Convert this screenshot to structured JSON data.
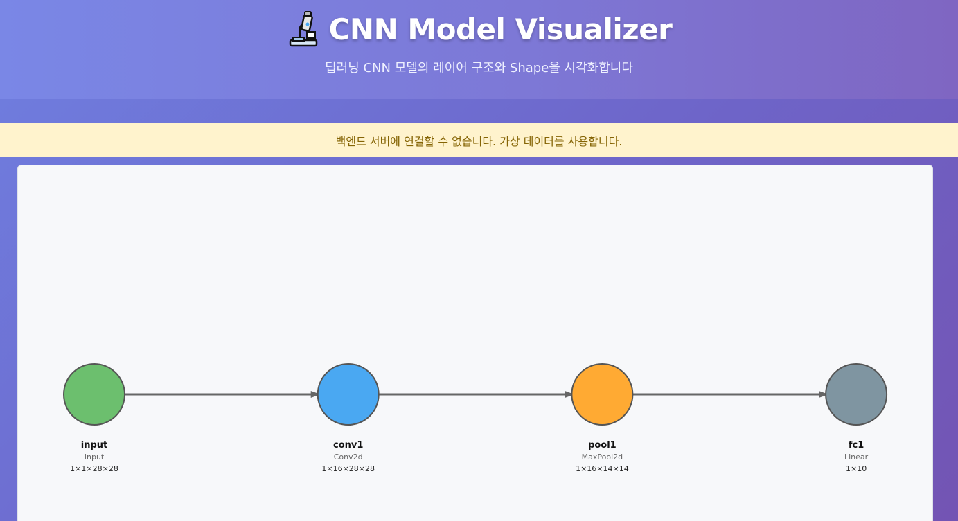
{
  "header": {
    "title": "CNN Model Visualizer",
    "title_icon": "microscope-icon",
    "subtitle": "딥러닝 CNN 모델의 레이어 구조와 Shape을 시각화합니다"
  },
  "alert": {
    "message": "백엔드 서버에 연결할 수 없습니다. 가상 데이터를 사용합니다."
  },
  "graph": {
    "nodes": [
      {
        "id": "input",
        "type": "Input",
        "shape": "1×1×28×28",
        "color": "#6cbf6e"
      },
      {
        "id": "conv1",
        "type": "Conv2d",
        "shape": "1×16×28×28",
        "color": "#4aa8f2"
      },
      {
        "id": "pool1",
        "type": "MaxPool2d",
        "shape": "1×16×14×14",
        "color": "#ffaa33"
      },
      {
        "id": "fc1",
        "type": "Linear",
        "shape": "1×10",
        "color": "#7f95a1"
      }
    ],
    "edges": [
      {
        "from": "input",
        "to": "conv1"
      },
      {
        "from": "conv1",
        "to": "pool1"
      },
      {
        "from": "pool1",
        "to": "fc1"
      }
    ],
    "edge_color": "#666666",
    "node_stroke": "#555555"
  }
}
